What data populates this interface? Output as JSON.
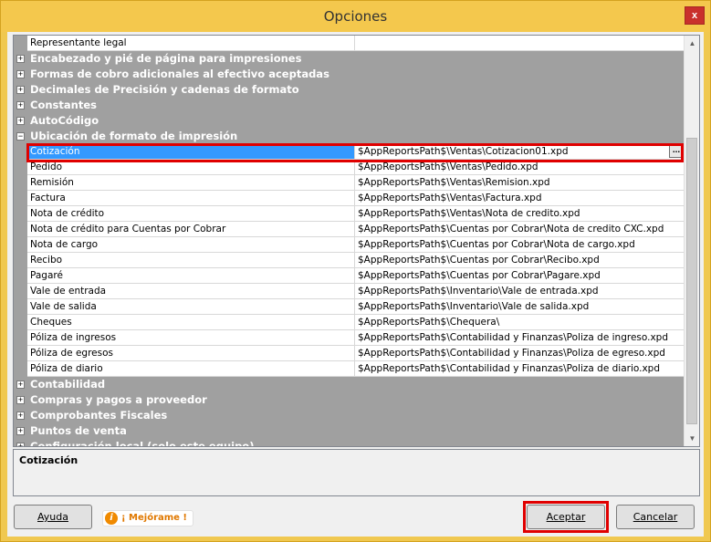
{
  "window": {
    "title": "Opciones",
    "close_glyph": "x"
  },
  "grid": {
    "rows": [
      {
        "kind": "prop",
        "name": "Representante legal",
        "value": ""
      },
      {
        "kind": "cat",
        "label": "Encabezado y pié de página para impresiones"
      },
      {
        "kind": "cat",
        "label": "Formas de cobro adicionales al efectivo aceptadas"
      },
      {
        "kind": "cat",
        "label": "Decimales de Precisión y cadenas de formato"
      },
      {
        "kind": "cat",
        "label": "Constantes"
      },
      {
        "kind": "cat",
        "label": "AutoCódigo"
      },
      {
        "kind": "cat",
        "label": "Ubicación de formato de impresión",
        "expanded": true
      },
      {
        "kind": "prop",
        "name": "Cotización",
        "value": "$AppReportsPath$\\Ventas\\Cotizacion01.xpd",
        "selected": true
      },
      {
        "kind": "prop",
        "name": "Pedido",
        "value": "$AppReportsPath$\\Ventas\\Pedido.xpd"
      },
      {
        "kind": "prop",
        "name": "Remisión",
        "value": "$AppReportsPath$\\Ventas\\Remision.xpd"
      },
      {
        "kind": "prop",
        "name": "Factura",
        "value": "$AppReportsPath$\\Ventas\\Factura.xpd"
      },
      {
        "kind": "prop",
        "name": "Nota de crédito",
        "value": "$AppReportsPath$\\Ventas\\Nota de credito.xpd"
      },
      {
        "kind": "prop",
        "name": "Nota de crédito para Cuentas por Cobrar",
        "value": "$AppReportsPath$\\Cuentas por Cobrar\\Nota de credito CXC.xpd"
      },
      {
        "kind": "prop",
        "name": "Nota de cargo",
        "value": "$AppReportsPath$\\Cuentas por Cobrar\\Nota de cargo.xpd"
      },
      {
        "kind": "prop",
        "name": "Recibo",
        "value": "$AppReportsPath$\\Cuentas por Cobrar\\Recibo.xpd"
      },
      {
        "kind": "prop",
        "name": "Pagaré",
        "value": "$AppReportsPath$\\Cuentas por Cobrar\\Pagare.xpd"
      },
      {
        "kind": "prop",
        "name": "Vale de entrada",
        "value": "$AppReportsPath$\\Inventario\\Vale de entrada.xpd"
      },
      {
        "kind": "prop",
        "name": "Vale de salida",
        "value": "$AppReportsPath$\\Inventario\\Vale de salida.xpd"
      },
      {
        "kind": "prop",
        "name": "Cheques",
        "value": "$AppReportsPath$\\Chequera\\"
      },
      {
        "kind": "prop",
        "name": "Póliza de ingresos",
        "value": "$AppReportsPath$\\Contabilidad y Finanzas\\Poliza de ingreso.xpd"
      },
      {
        "kind": "prop",
        "name": "Póliza de egresos",
        "value": "$AppReportsPath$\\Contabilidad y Finanzas\\Poliza de egreso.xpd"
      },
      {
        "kind": "prop",
        "name": "Póliza de diario",
        "value": "$AppReportsPath$\\Contabilidad y Finanzas\\Poliza de diario.xpd"
      },
      {
        "kind": "cat",
        "label": "Contabilidad"
      },
      {
        "kind": "cat",
        "label": "Compras y pagos a proveedor"
      },
      {
        "kind": "cat",
        "label": "Comprobantes Fiscales"
      },
      {
        "kind": "cat",
        "label": "Puntos de venta"
      },
      {
        "kind": "cat",
        "label": "Configuración local (solo este equipo)"
      }
    ],
    "ellipsis_label": "..."
  },
  "description": {
    "title": "Cotización"
  },
  "buttons": {
    "help": "Ayuda",
    "improve": "¡ Mejórame !",
    "improve_icon": "i",
    "accept": "Aceptar",
    "cancel": "Cancelar"
  },
  "colors": {
    "title_bar": "#f4c84d",
    "selection": "#3399ff",
    "annotation": "#e00000",
    "category_bg": "#a0a0a0"
  }
}
